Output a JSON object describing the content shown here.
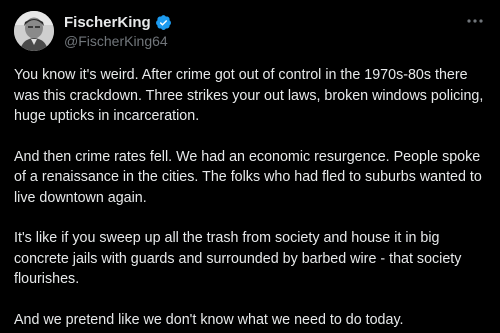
{
  "author": {
    "display_name": "FischerKing",
    "handle": "@FischerKing64",
    "verified": true,
    "avatar_icon": "avatar-portrait-icon",
    "verified_icon": "verified-badge-icon"
  },
  "menu": {
    "icon": "more-horizontal-icon"
  },
  "colors": {
    "background": "#000000",
    "text": "#e7e9ea",
    "secondary_text": "#71767b",
    "verified_blue": "#1d9bf0"
  },
  "tweet": {
    "paragraphs": [
      "You know it's weird. After crime got out of control in the 1970s-80s there was this crackdown. Three strikes your out laws, broken windows policing, huge upticks in incarceration.",
      "And then crime rates fell. We had an economic resurgence. People spoke of a renaissance in the cities. The folks who had fled to suburbs wanted to live downtown again.",
      "It's like if you sweep up all the trash from society and house it in big concrete jails with guards and surrounded by barbed wire - that society flourishes.",
      "And we pretend like we don't know what we need to do today."
    ]
  }
}
